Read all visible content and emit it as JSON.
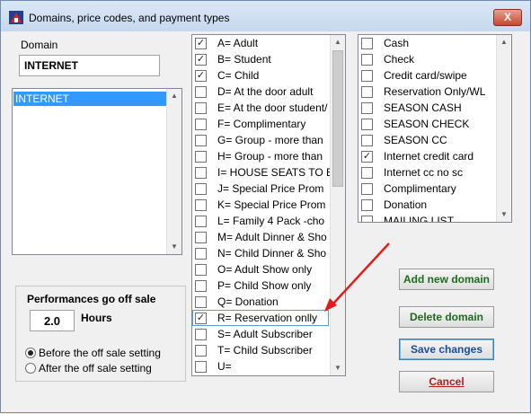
{
  "window": {
    "title": "Domains, price codes, and payment types",
    "close_glyph": "X"
  },
  "domain": {
    "label": "Domain",
    "value": "INTERNET",
    "list": [
      "INTERNET"
    ]
  },
  "price_codes": [
    {
      "label": "A= Adult",
      "checked": true
    },
    {
      "label": "B= Student",
      "checked": true
    },
    {
      "label": "C= Child",
      "checked": true
    },
    {
      "label": "D= At the door adult",
      "checked": false
    },
    {
      "label": "E= At the door student/",
      "checked": false
    },
    {
      "label": "F= Complimentary",
      "checked": false
    },
    {
      "label": "G= Group - more than",
      "checked": false
    },
    {
      "label": "H= Group - more than",
      "checked": false
    },
    {
      "label": "I= HOUSE SEATS TO B",
      "checked": false
    },
    {
      "label": "J= Special Price Prom",
      "checked": false
    },
    {
      "label": "K= Special Price Prom",
      "checked": false
    },
    {
      "label": "L= Family 4 Pack -cho",
      "checked": false
    },
    {
      "label": "M= Adult Dinner & Sho",
      "checked": false
    },
    {
      "label": "N= Child Dinner & Sho",
      "checked": false
    },
    {
      "label": "O= Adult Show only",
      "checked": false
    },
    {
      "label": "P= Child Show only",
      "checked": false
    },
    {
      "label": "Q= Donation",
      "checked": false
    },
    {
      "label": "R= Reservation onlly",
      "checked": true
    },
    {
      "label": "S= Adult Subscriber",
      "checked": false
    },
    {
      "label": "T= Child Subscriber",
      "checked": false
    },
    {
      "label": "U=",
      "checked": false
    }
  ],
  "payment_types": [
    {
      "label": "Cash",
      "checked": false
    },
    {
      "label": "Check",
      "checked": false
    },
    {
      "label": "Credit card/swipe",
      "checked": false
    },
    {
      "label": "Reservation Only/WL",
      "checked": false
    },
    {
      "label": "SEASON CASH",
      "checked": false
    },
    {
      "label": "SEASON CHECK",
      "checked": false
    },
    {
      "label": "SEASON CC",
      "checked": false
    },
    {
      "label": "Internet credit card",
      "checked": true
    },
    {
      "label": "Internet cc no sc",
      "checked": false
    },
    {
      "label": "Complimentary",
      "checked": false
    },
    {
      "label": "Donation",
      "checked": false
    },
    {
      "label": "MAILING LIST",
      "checked": false
    }
  ],
  "off_sale": {
    "heading": "Performances go off sale",
    "value": "2.0",
    "unit": "Hours",
    "options": [
      "Before the off sale setting",
      "After the off sale setting"
    ],
    "selected": 0
  },
  "buttons": {
    "add": "Add new domain",
    "delete": "Delete domain",
    "save": "Save changes",
    "cancel": "Cancel"
  },
  "colors": {
    "annotation_arrow": "#e21b1b",
    "selection": "#3399ff"
  }
}
